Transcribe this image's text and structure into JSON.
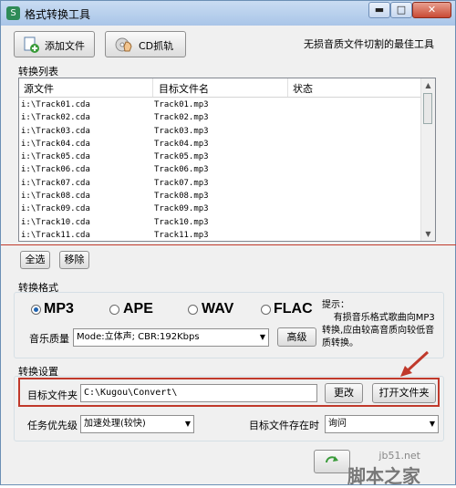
{
  "window": {
    "title": "格式转换工具"
  },
  "toolbar": {
    "add_file": "添加文件",
    "cd_grab": "CD抓轨",
    "slogan": "无损音质文件切割的最佳工具"
  },
  "list": {
    "section_label": "转换列表",
    "columns": [
      "源文件",
      "目标文件名",
      "状态"
    ],
    "rows": [
      [
        "i:\\Track01.cda",
        "Track01.mp3",
        ""
      ],
      [
        "i:\\Track02.cda",
        "Track02.mp3",
        ""
      ],
      [
        "i:\\Track03.cda",
        "Track03.mp3",
        ""
      ],
      [
        "i:\\Track04.cda",
        "Track04.mp3",
        ""
      ],
      [
        "i:\\Track05.cda",
        "Track05.mp3",
        ""
      ],
      [
        "i:\\Track06.cda",
        "Track06.mp3",
        ""
      ],
      [
        "i:\\Track07.cda",
        "Track07.mp3",
        ""
      ],
      [
        "i:\\Track08.cda",
        "Track08.mp3",
        ""
      ],
      [
        "i:\\Track09.cda",
        "Track09.mp3",
        ""
      ],
      [
        "i:\\Track10.cda",
        "Track10.mp3",
        ""
      ],
      [
        "i:\\Track11.cda",
        "Track11.mp3",
        ""
      ]
    ],
    "select_all": "全选",
    "remove": "移除"
  },
  "format": {
    "section_label": "转换格式",
    "options": [
      "MP3",
      "APE",
      "WAV",
      "FLAC"
    ],
    "selected": "MP3",
    "hint": "提示：\n    有损音乐格式歌曲向MP3转换,应由较高音质向较低音质转换。",
    "quality_label": "音乐质量",
    "quality_value": "Mode:立体声; CBR:192Kbps",
    "advanced": "高级"
  },
  "settings": {
    "section_label": "转换设置",
    "target_folder_label": "目标文件夹",
    "target_folder_value": "C:\\Kugou\\Convert\\",
    "change": "更改",
    "open_folder": "打开文件夹",
    "priority_label": "任务优先级",
    "priority_value": "加速处理(较快)",
    "exists_label": "目标文件存在时",
    "exists_value": "询问"
  },
  "watermark": {
    "site": "jb51.net",
    "brand": "脚本之家"
  },
  "colors": {
    "highlight": "#c0392b",
    "selected_radio": "#1f63b0"
  }
}
